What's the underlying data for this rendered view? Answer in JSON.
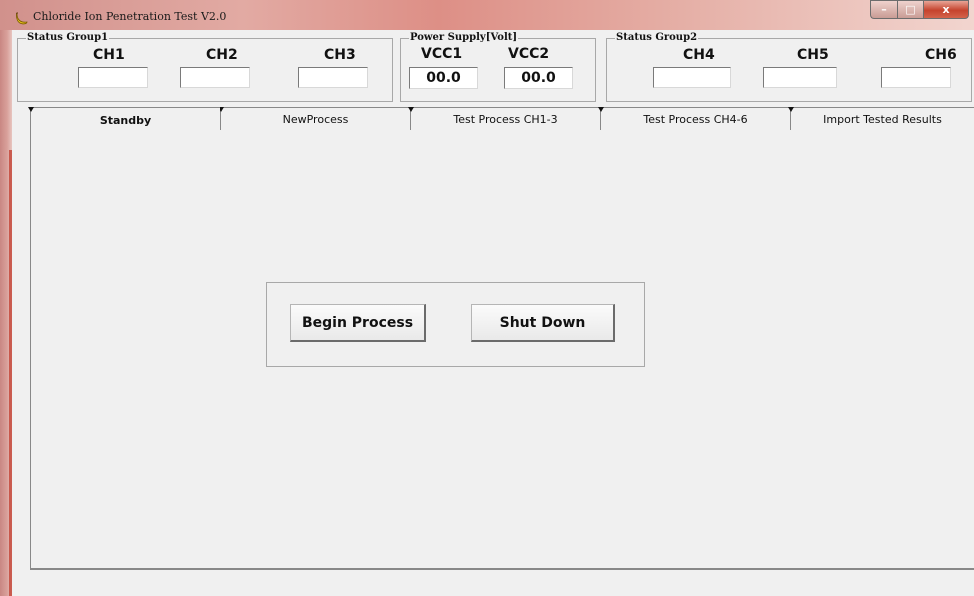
{
  "window": {
    "title": "Chloride Ion Penetration Test V2.0",
    "icon": "banana-icon",
    "controls": {
      "minimize": "–",
      "maximize": "□",
      "close": "x"
    }
  },
  "status_group1": {
    "title": "Status Group1",
    "channels": [
      {
        "label": "CH1",
        "value": ""
      },
      {
        "label": "CH2",
        "value": ""
      },
      {
        "label": "CH3",
        "value": ""
      }
    ]
  },
  "power_supply": {
    "title": "Power Supply[Volt]",
    "channels": [
      {
        "label": "VCC1",
        "value": "00.0"
      },
      {
        "label": "VCC2",
        "value": "00.0"
      }
    ]
  },
  "status_group2": {
    "title": "Status Group2",
    "channels": [
      {
        "label": "CH4",
        "value": ""
      },
      {
        "label": "CH5",
        "value": ""
      },
      {
        "label": "CH6",
        "value": ""
      }
    ]
  },
  "tabs": [
    {
      "label": "Standby",
      "active": true
    },
    {
      "label": "NewProcess",
      "active": false
    },
    {
      "label": "Test Process CH1-3",
      "active": false
    },
    {
      "label": "Test Process CH4-6",
      "active": false
    },
    {
      "label": "Import Tested Results",
      "active": false
    }
  ],
  "standby": {
    "begin_label": "Begin Process",
    "shutdown_label": "Shut Down"
  }
}
